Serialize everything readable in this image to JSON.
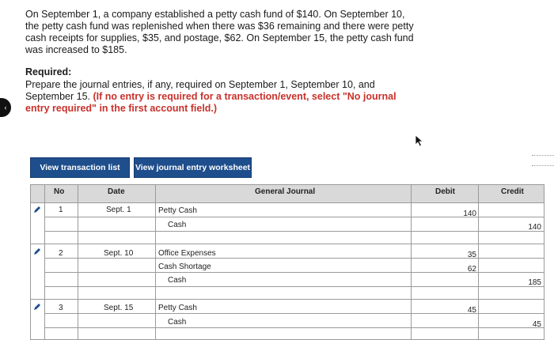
{
  "problem": {
    "text": "On September 1, a company established a petty cash fund of $140. On September 10, the petty cash fund was replenished when there was $36 remaining and there were petty cash receipts for supplies, $35, and postage, $62. On September 15, the petty cash fund was increased to $185."
  },
  "required": {
    "heading": "Required:",
    "text": "Prepare the journal entries, if any, required on September 1, September 10, and September 15.",
    "note": "(If no entry is required for a transaction/event, select \"No journal entry required\" in the first account field.)"
  },
  "tabs": {
    "transaction_list": "View transaction list",
    "journal_worksheet": "View journal entry worksheet"
  },
  "table": {
    "headers": {
      "no": "No",
      "date": "Date",
      "journal": "General Journal",
      "debit": "Debit",
      "credit": "Credit"
    },
    "rows": [
      {
        "no": "1",
        "date": "Sept. 1",
        "account": "Petty Cash",
        "debit": "140",
        "credit": ""
      },
      {
        "no": "",
        "date": "",
        "account": "Cash",
        "debit": "",
        "credit": "140"
      },
      {
        "no": "",
        "date": "",
        "account": "",
        "debit": "",
        "credit": ""
      },
      {
        "no": "2",
        "date": "Sept. 10",
        "account": "Office Expenses",
        "debit": "35",
        "credit": ""
      },
      {
        "no": "",
        "date": "",
        "account": "Cash Shortage",
        "debit": "62",
        "credit": ""
      },
      {
        "no": "",
        "date": "",
        "account": "Cash",
        "debit": "",
        "credit": "185"
      },
      {
        "no": "",
        "date": "",
        "account": "",
        "debit": "",
        "credit": ""
      },
      {
        "no": "3",
        "date": "Sept. 15",
        "account": "Petty Cash",
        "debit": "45",
        "credit": ""
      },
      {
        "no": "",
        "date": "",
        "account": "Cash",
        "debit": "",
        "credit": "45"
      }
    ]
  },
  "left_tab_glyph": "‹",
  "colors": {
    "button_bg": "#1e4e8c",
    "red_note": "#c8312b",
    "edit_icon": "#1e4e8c"
  }
}
